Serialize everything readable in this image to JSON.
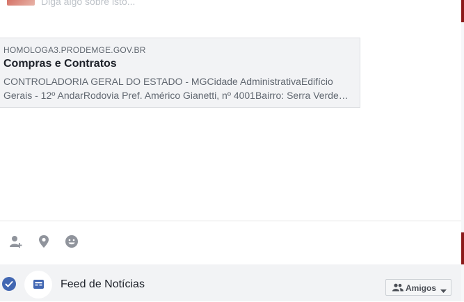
{
  "composer": {
    "placeholder": "Diga algo sobre isto..."
  },
  "link_preview": {
    "domain": "HOMOLOGA3.PRODEMGE.GOV.BR",
    "title": "Compras e Contratos",
    "description_line1": "CONTROLADORIA GERAL DO ESTADO - MGCidade AdministrativaEdifício",
    "description_line2": "Gerais - 12º AndarRodovia Pref. Américo Gianetti, nº 4001Bairro: Serra Verde…"
  },
  "actions": {
    "icons": [
      "tag-friends-icon",
      "check-in-icon",
      "feeling-icon"
    ]
  },
  "share_to": {
    "label": "Feed de Notícias",
    "checked": true,
    "audience_label": "Amigos"
  },
  "colors": {
    "accent": "#4267b2",
    "icon_gray": "#90949c"
  }
}
